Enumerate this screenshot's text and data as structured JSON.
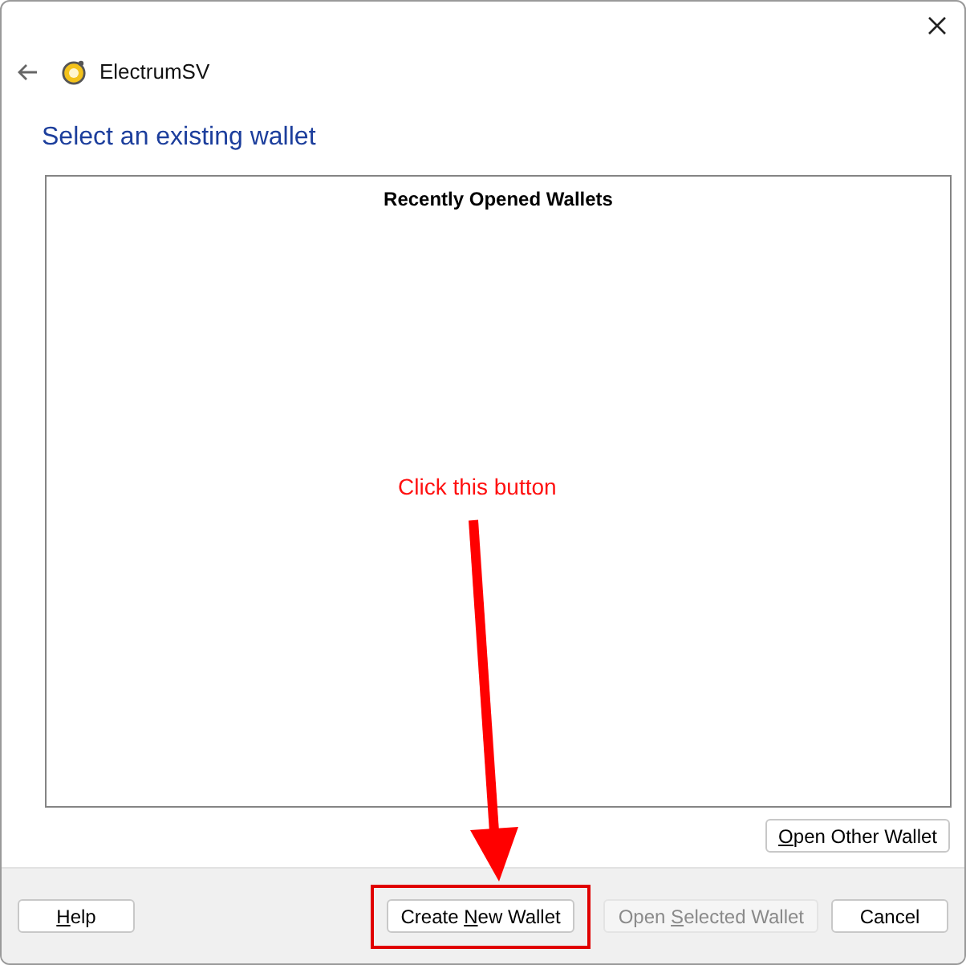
{
  "window": {
    "app_name": "ElectrumSV"
  },
  "page_title": "Select an existing wallet",
  "wallet_list": {
    "header": "Recently Opened Wallets"
  },
  "open_other_button": {
    "label": [
      {
        "text": "O",
        "underlined": true
      },
      {
        "text": "pen Other Wallet",
        "underlined": false
      }
    ],
    "disabled": false
  },
  "footer_buttons": [
    {
      "label": [
        {
          "text": "H",
          "underlined": true
        },
        {
          "text": "elp",
          "underlined": false
        }
      ],
      "disabled": false,
      "highlighted": false
    },
    {
      "label": [
        {
          "text": "Create ",
          "underlined": false
        },
        {
          "text": "N",
          "underlined": true
        },
        {
          "text": "ew Wallet",
          "underlined": false
        }
      ],
      "disabled": false,
      "highlighted": true
    },
    {
      "label": [
        {
          "text": "Open ",
          "underlined": false
        },
        {
          "text": "S",
          "underlined": true
        },
        {
          "text": "elected Wallet",
          "underlined": false
        }
      ],
      "disabled": true,
      "highlighted": false
    },
    {
      "label": [
        {
          "text": "Cancel",
          "underlined": false
        }
      ],
      "disabled": false,
      "highlighted": false
    }
  ],
  "annotation": {
    "text": "Click this button"
  }
}
